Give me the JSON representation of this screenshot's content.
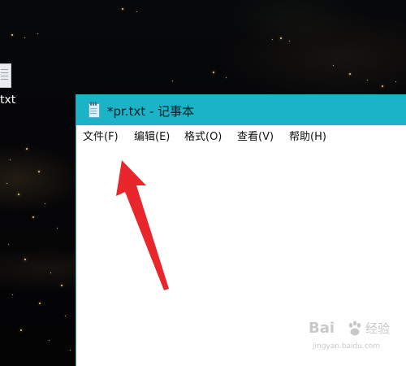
{
  "desktop": {
    "icon_label": "txt",
    "icon_name": "text-file-icon"
  },
  "window": {
    "title": "*pr.txt - 记事本",
    "app_icon": "notepad-icon",
    "title_bar_color": "#1ab3c7"
  },
  "menu": {
    "items": [
      {
        "label": "文件(F)",
        "id": "file"
      },
      {
        "label": "编辑(E)",
        "id": "edit"
      },
      {
        "label": "格式(O)",
        "id": "format"
      },
      {
        "label": "查看(V)",
        "id": "view"
      },
      {
        "label": "帮助(H)",
        "id": "help"
      }
    ]
  },
  "editor": {
    "content": ""
  },
  "annotation": {
    "type": "red-arrow",
    "color": "#e8262b",
    "points_to": "文件(F)"
  },
  "watermark": {
    "brand": "Bai",
    "sub": "经验",
    "url": "jingyan.baidu.com"
  }
}
